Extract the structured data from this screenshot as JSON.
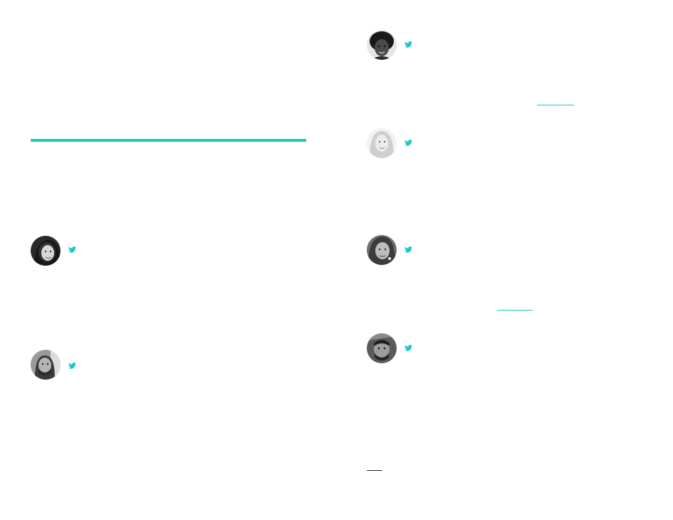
{
  "colors": {
    "accent": "#18c8c8",
    "link_underline": "#18c8c8",
    "dark_underline": "#222222"
  },
  "icons": {
    "social": "twitter-icon"
  },
  "people": [
    {
      "avatar": "avatar-woman-dark-hair",
      "social_icon": "twitter-icon"
    },
    {
      "avatar": "avatar-man-beard",
      "social_icon": "twitter-icon"
    },
    {
      "avatar": "avatar-woman-curly-hair",
      "social_icon": "twitter-icon"
    },
    {
      "avatar": "avatar-woman-blonde",
      "social_icon": "twitter-icon"
    },
    {
      "avatar": "avatar-woman-short-hair",
      "social_icon": "twitter-icon"
    },
    {
      "avatar": "avatar-man-dark",
      "social_icon": "twitter-icon"
    }
  ]
}
